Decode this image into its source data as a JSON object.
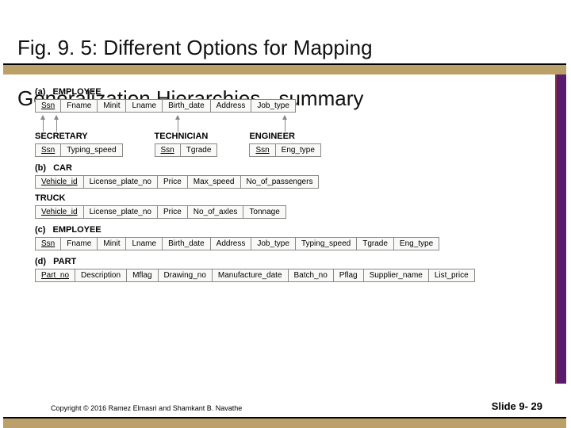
{
  "title_line1": "Fig. 9. 5: Different Options for Mapping",
  "title_line2": "Generalization Hierarchies - summary",
  "a": {
    "label": "(a)",
    "name": "EMPLOYEE",
    "super_cols": [
      "Ssn",
      "Fname",
      "Minit",
      "Lname",
      "Birth_date",
      "Address",
      "Job_type"
    ],
    "super_key_idx": 0,
    "subs": [
      {
        "name": "SECRETARY",
        "cols": [
          "Ssn",
          "Typing_speed"
        ],
        "key_idx": 0
      },
      {
        "name": "TECHNICIAN",
        "cols": [
          "Ssn",
          "Tgrade"
        ],
        "key_idx": 0
      },
      {
        "name": "ENGINEER",
        "cols": [
          "Ssn",
          "Eng_type"
        ],
        "key_idx": 0
      }
    ]
  },
  "b": {
    "label": "(b)",
    "car": {
      "name": "CAR",
      "cols": [
        "Vehicle_id",
        "License_plate_no",
        "Price",
        "Max_speed",
        "No_of_passengers"
      ],
      "key_idx": 0
    },
    "truck": {
      "name": "TRUCK",
      "cols": [
        "Vehicle_id",
        "License_plate_no",
        "Price",
        "No_of_axles",
        "Tonnage"
      ],
      "key_idx": 0
    }
  },
  "c": {
    "label": "(c)",
    "name": "EMPLOYEE",
    "cols": [
      "Ssn",
      "Fname",
      "Minit",
      "Lname",
      "Birth_date",
      "Address",
      "Job_type",
      "Typing_speed",
      "Tgrade",
      "Eng_type"
    ],
    "key_idx": 0
  },
  "d": {
    "label": "(d)",
    "name": "PART",
    "cols": [
      "Part_no",
      "Description",
      "Mflag",
      "Drawing_no",
      "Manufacture_date",
      "Batch_no",
      "Pflag",
      "Supplier_name",
      "List_price"
    ],
    "key_idx": 0
  },
  "footer": {
    "copyright": "Copyright © 2016 Ramez Elmasri and Shamkant B. Navathe",
    "slide": "Slide 9- 29"
  }
}
